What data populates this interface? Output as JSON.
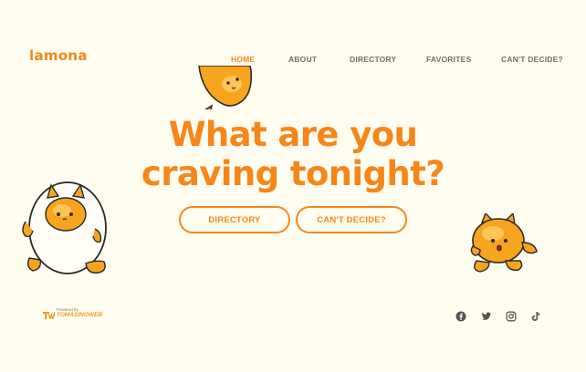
{
  "logo": {
    "text": "lamona"
  },
  "nav": {
    "items": [
      {
        "label": "HOME",
        "active": true
      },
      {
        "label": "ABOUT",
        "active": false
      },
      {
        "label": "DIRECTORY",
        "active": false
      },
      {
        "label": "FAVORITES",
        "active": false
      },
      {
        "label": "CAN'T DECIDE?",
        "active": false
      }
    ]
  },
  "hero": {
    "line1": "What are you",
    "line2": "craving tonight?"
  },
  "cta": {
    "directory_label": "DIRECTORY",
    "cant_decide_label": "CAN'T DECIDE?"
  },
  "footer": {
    "powered_by": "Powered by",
    "brand": "TOMASINOWEB",
    "social_icons": [
      "facebook-icon",
      "twitter-icon",
      "instagram-icon",
      "tiktok-icon"
    ]
  },
  "colors": {
    "accent": "#f7861a",
    "background": "#fffdf0",
    "nav_text": "#6f6f6f",
    "mascot_fill": "#f7a41e"
  }
}
